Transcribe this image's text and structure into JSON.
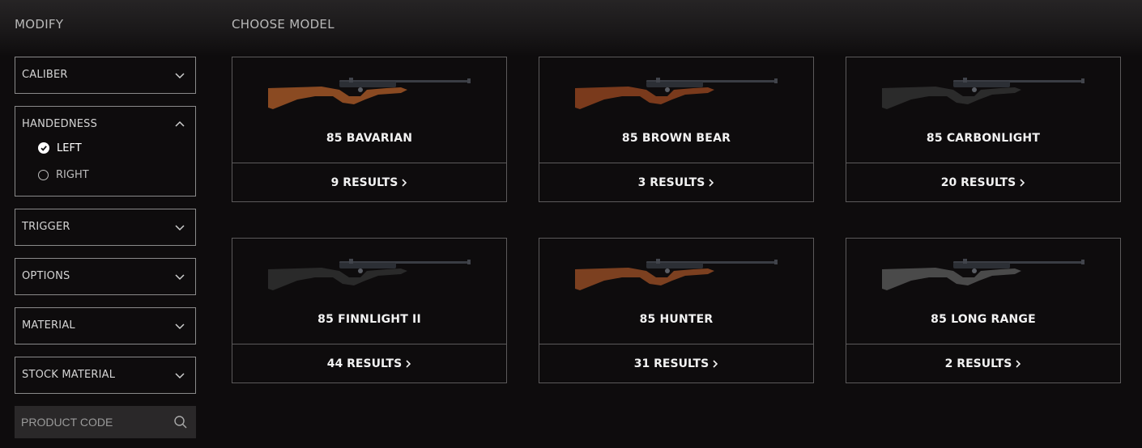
{
  "sidebar": {
    "title": "MODIFY",
    "filters": [
      {
        "label": "CALIBER"
      },
      {
        "label": "HANDEDNESS",
        "options": [
          {
            "label": "LEFT",
            "selected": true
          },
          {
            "label": "RIGHT",
            "selected": false
          }
        ]
      },
      {
        "label": "TRIGGER"
      },
      {
        "label": "OPTIONS"
      },
      {
        "label": "MATERIAL"
      },
      {
        "label": "STOCK MATERIAL"
      }
    ],
    "search": {
      "placeholder": "PRODUCT CODE",
      "icon": "search-icon"
    }
  },
  "main": {
    "title": "CHOOSE MODEL",
    "models": [
      {
        "name": "85 BAVARIAN",
        "results": "9 RESULTS",
        "stock": "#8a4a22"
      },
      {
        "name": "85 BROWN BEAR",
        "results": "3 RESULTS",
        "stock": "#7a3a1c"
      },
      {
        "name": "85 CARBONLIGHT",
        "results": "20 RESULTS",
        "stock": "#2b2b2b"
      },
      {
        "name": "85 FINNLIGHT II",
        "results": "44 RESULTS",
        "stock": "#2a2a2a"
      },
      {
        "name": "85 HUNTER",
        "results": "31 RESULTS",
        "stock": "#7c4020"
      },
      {
        "name": "85 LONG RANGE",
        "results": "2 RESULTS",
        "stock": "#4a4a4a"
      }
    ]
  },
  "colors": {
    "background": "#0e0c0d",
    "border": "#8a8a8a",
    "card_border": "#5c5a5b",
    "search_bg": "#2a2829",
    "text": "#f2f2f2"
  }
}
